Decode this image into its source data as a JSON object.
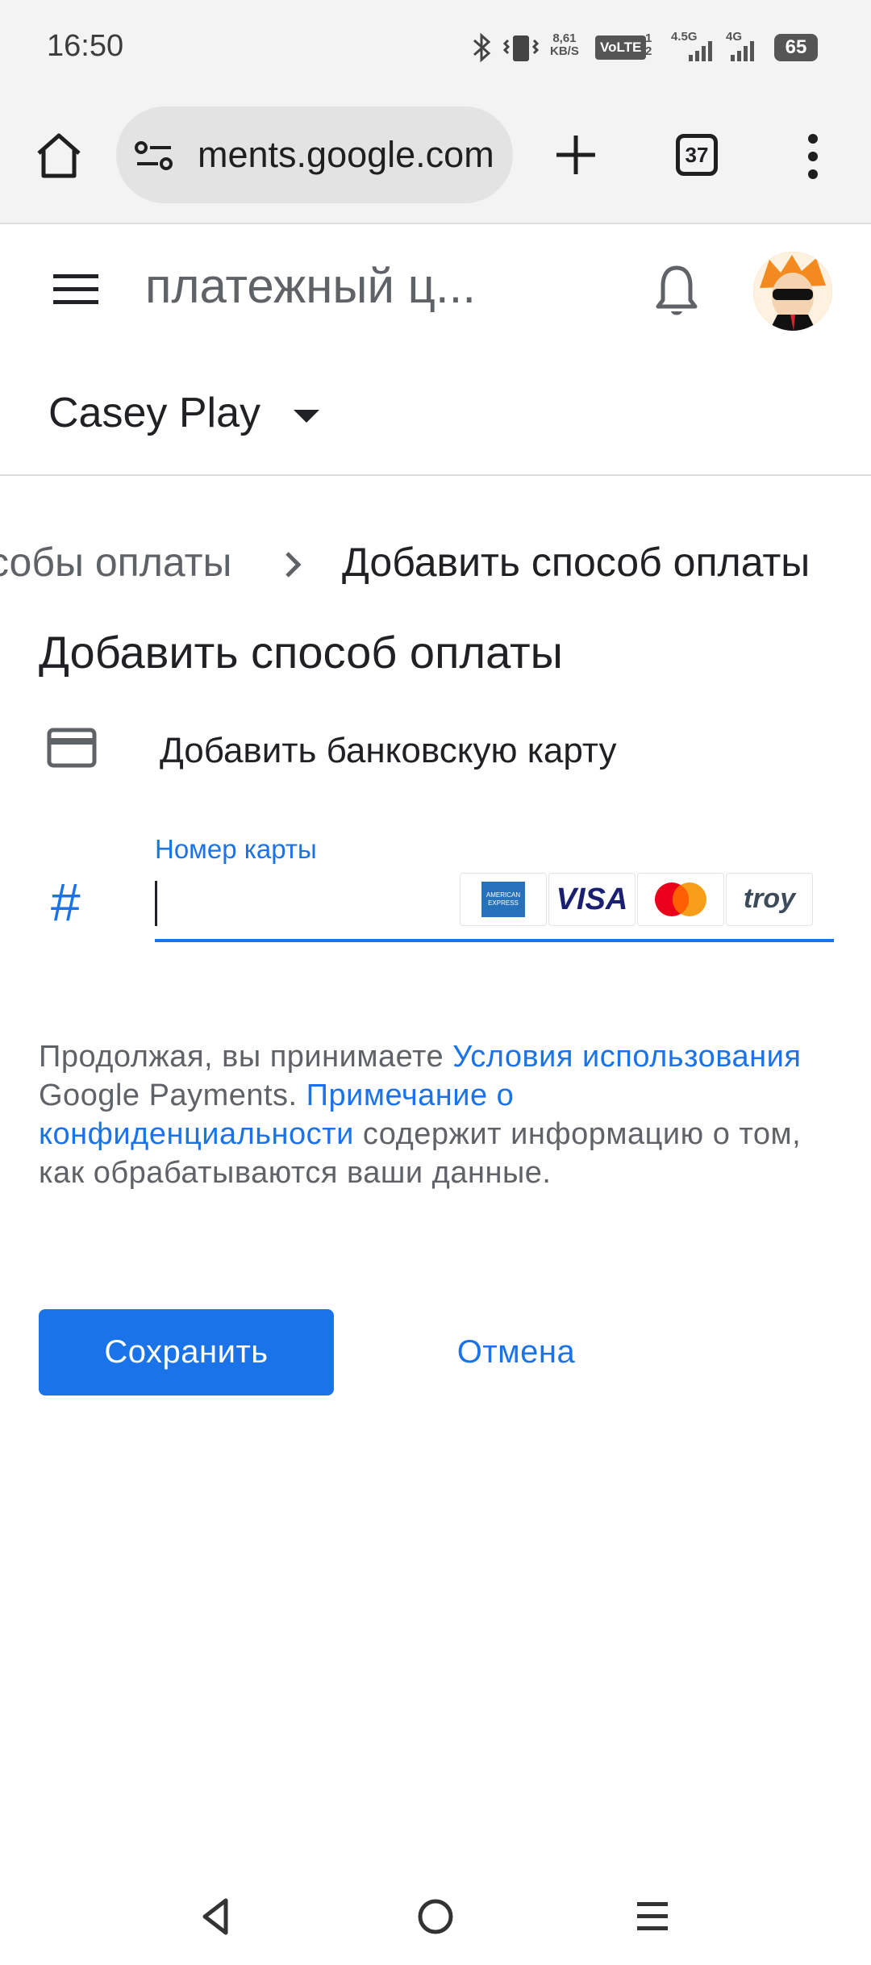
{
  "status_bar": {
    "time": "16:50",
    "net_speed": "8,61\nKB/S",
    "volte": "VoLTE",
    "sim_slots": "1\n2",
    "signal1": "4.5G",
    "signal2": "4G",
    "battery": "65"
  },
  "browser": {
    "url": "ments.google.com",
    "tab_count": "37"
  },
  "header": {
    "title": "платежный ц...",
    "account": "Casey Play"
  },
  "breadcrumb": {
    "previous": "собы оплаты",
    "current": "Добавить способ оплаты"
  },
  "main": {
    "heading": "Добавить способ оплаты",
    "add_card_label": "Добавить банковскую карту",
    "card_number_label": "Номер карты",
    "card_number_value": "",
    "card_logos": [
      "AMERICAN EXPRESS",
      "VISA",
      "mastercard",
      "troy"
    ],
    "terms": {
      "prefix": "Продолжая, вы принимаете ",
      "terms_link": "Условия использования",
      "middle": " Google Payments. ",
      "privacy_link": "Примечание о конфиденциальности",
      "suffix": " содержит информацию о том, как обрабатываются ваши данные."
    },
    "save_label": "Сохранить",
    "cancel_label": "Отмена"
  },
  "colors": {
    "accent": "#1a73e8",
    "text_secondary": "#5f6368"
  }
}
